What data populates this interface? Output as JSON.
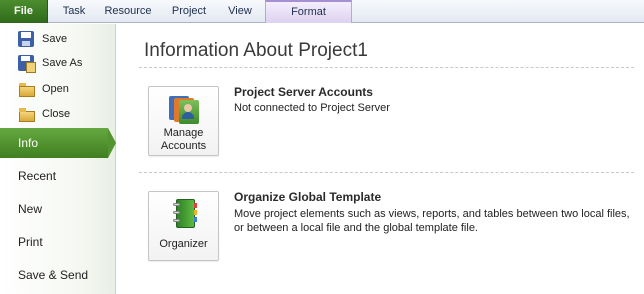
{
  "ribbon": {
    "tabs": [
      {
        "label": "File"
      },
      {
        "label": "Task"
      },
      {
        "label": "Resource"
      },
      {
        "label": "Project"
      },
      {
        "label": "View"
      },
      {
        "label": "Format"
      }
    ]
  },
  "nav": {
    "commands": [
      {
        "label": "Save",
        "icon": "save-icon"
      },
      {
        "label": "Save As",
        "icon": "save-as-icon"
      },
      {
        "label": "Open",
        "icon": "open-folder-icon"
      },
      {
        "label": "Close",
        "icon": "close-folder-icon"
      }
    ],
    "tabs": [
      {
        "label": "Info",
        "active": true
      },
      {
        "label": "Recent"
      },
      {
        "label": "New"
      },
      {
        "label": "Print"
      },
      {
        "label": "Save & Send"
      }
    ]
  },
  "main": {
    "title": "Information About Project1",
    "sections": [
      {
        "button_label_line1": "Manage",
        "button_label_line2": "Accounts",
        "button_icon": "manage-accounts-icon",
        "heading": "Project Server Accounts",
        "text_line1": "Not connected to Project Server"
      },
      {
        "button_label_line1": "Organizer",
        "button_icon": "organizer-icon",
        "heading": "Organize Global Template",
        "text_line1": "Move project elements such as views, reports, and tables between two local files,",
        "text_line2": "or between a local file and the global template file."
      }
    ]
  },
  "colors": {
    "file_tab": "#3f7f21",
    "active_nav": "#52942f",
    "format_tab": "#ddd2f0"
  }
}
